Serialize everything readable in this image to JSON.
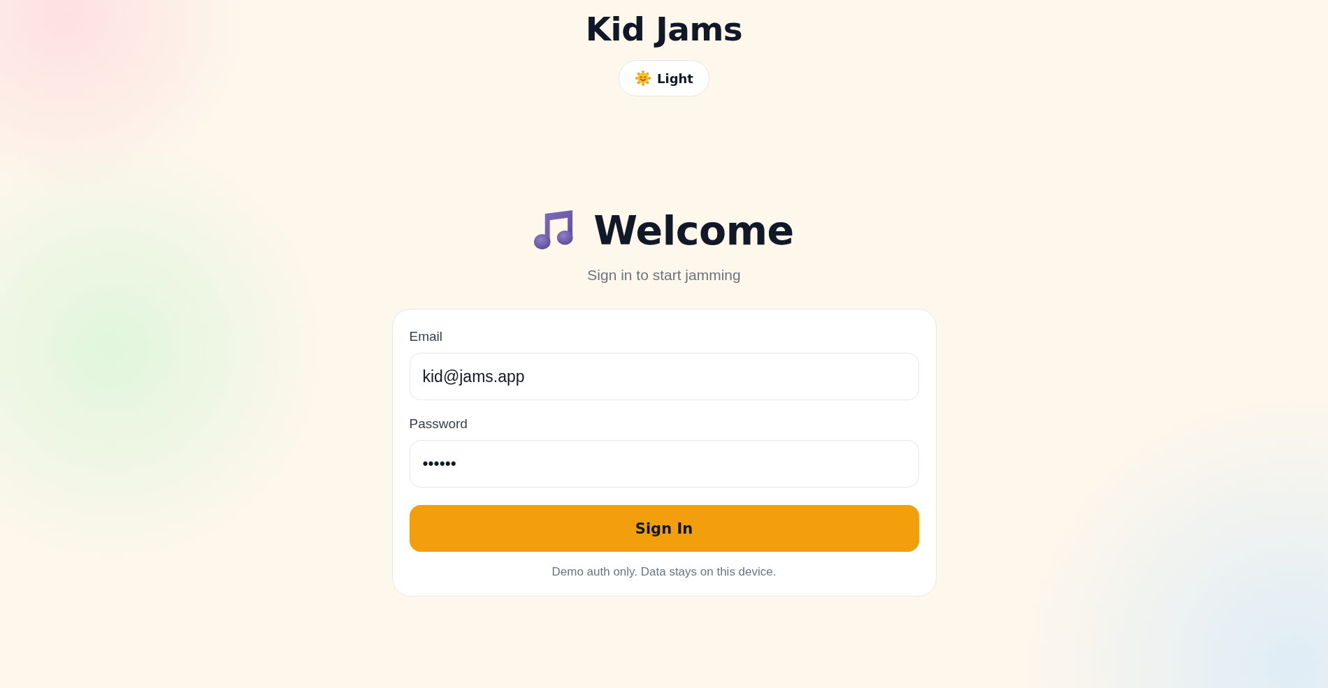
{
  "header": {
    "title": "Kid Jams",
    "theme_toggle": {
      "label": "Light"
    }
  },
  "welcome": {
    "title": "Welcome",
    "subtitle": "Sign in to start jamming"
  },
  "form": {
    "fields": [
      {
        "kind": "email",
        "label": "Email",
        "value": "kid@jams.app"
      },
      {
        "kind": "password",
        "label": "Password",
        "value": "••••••"
      }
    ],
    "submit": "Sign In",
    "note": "Demo auth only. Data stays on this device."
  }
}
